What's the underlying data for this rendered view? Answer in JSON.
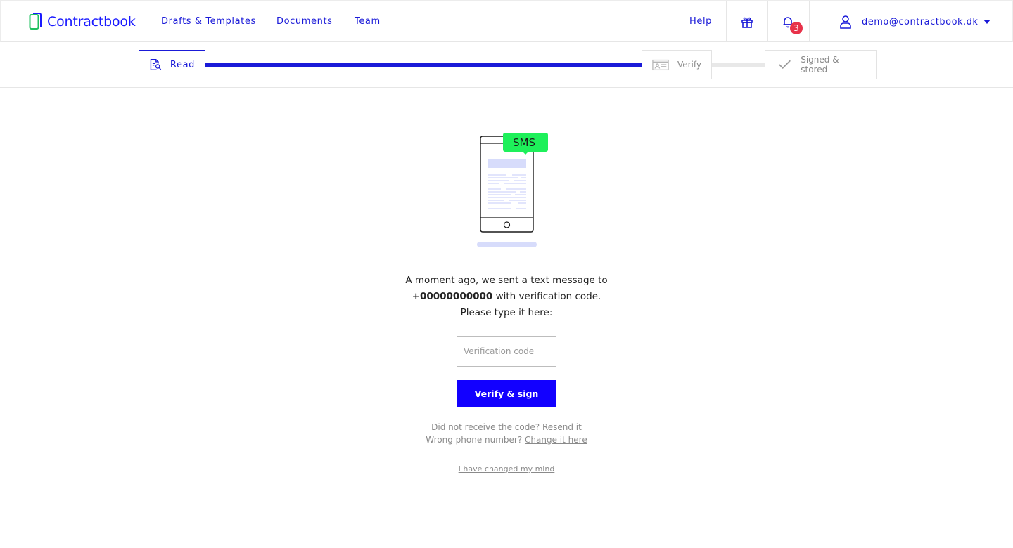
{
  "nav": {
    "logo_text": "Contractbook",
    "links": [
      "Drafts & Templates",
      "Documents",
      "Team"
    ],
    "help": "Help",
    "notifications_count": "3",
    "user_email": "demo@contractbook.dk",
    "icons": {
      "logo": "contractbook-logo-icon",
      "gift": "gift-icon",
      "bell": "bell-icon",
      "user": "user-icon",
      "caret": "caret-down-icon"
    }
  },
  "progress": {
    "steps": [
      {
        "label": "Read",
        "icon": "document-search-icon",
        "state": "active"
      },
      {
        "label": "Verify",
        "icon": "id-card-icon",
        "state": "pending"
      },
      {
        "label": "Signed & stored",
        "icon": "check-icon",
        "state": "pending"
      }
    ],
    "colors": {
      "active": "#1a1ad8",
      "inactive": "#e8e8e8"
    }
  },
  "illustration": {
    "badge_text": "SMS",
    "badge_color": "#1ef05a",
    "icon": "phone-sms-icon"
  },
  "message": {
    "line1": "A moment ago, we sent a text message to",
    "phone": "+00000000000",
    "line2_suffix": " with verification code.",
    "line3": "Please type it here:"
  },
  "form": {
    "code_placeholder": "Verification code",
    "code_value": "",
    "submit_label": "Verify & sign",
    "submit_color": "#1200ff"
  },
  "help": {
    "resend_prefix": "Did not receive the code? ",
    "resend_link": "Resend it",
    "change_prefix": "Wrong phone number? ",
    "change_link": "Change it here",
    "changed_mind": "I have changed my mind"
  }
}
